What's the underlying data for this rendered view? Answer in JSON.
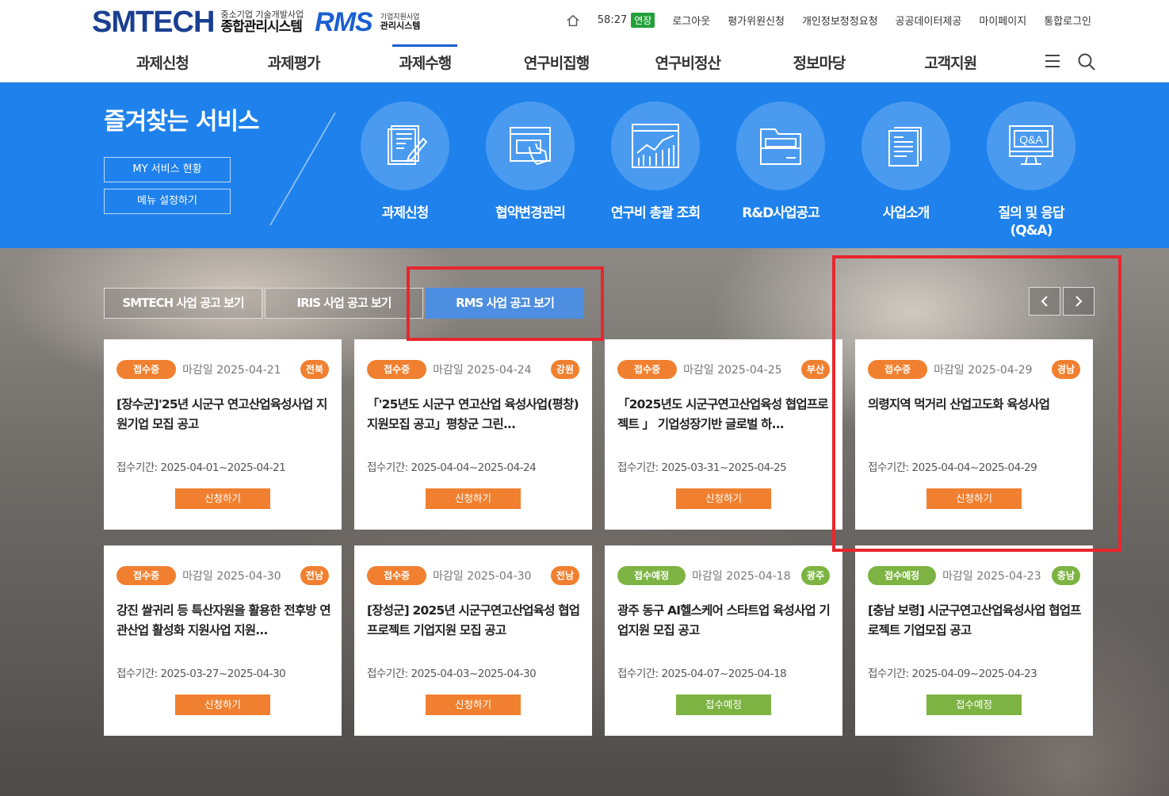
{
  "header": {
    "logo_smtech": "SMTECH",
    "logo_smtech_sub1": "중소기업 기술개발사업",
    "logo_smtech_sub2": "종합관리시스템",
    "logo_rms": "RMS",
    "logo_rms_sub1": "기업지원사업",
    "logo_rms_sub2": "관리시스템",
    "session_time": "58:27",
    "extend_label": "연장",
    "util_links": [
      "로그아웃",
      "평가위원신청",
      "개인정보정정요청",
      "공공데이터제공",
      "마이페이지",
      "통합로그인"
    ],
    "gnb": [
      "과제신청",
      "과제평가",
      "과제수행",
      "연구비집행",
      "연구비정산",
      "정보마당",
      "고객지원"
    ],
    "gnb_active_index": 2
  },
  "favorites": {
    "title": "즐겨찾는 서비스",
    "my_service": "MY 서비스 현황",
    "menu_setting": "메뉴 설정하기",
    "services": [
      {
        "label": "과제신청",
        "icon": "document-edit-icon"
      },
      {
        "label": "협약변경관리",
        "icon": "window-hand-icon"
      },
      {
        "label": "연구비 총괄 조회",
        "icon": "chart-icon"
      },
      {
        "label": "R&D사업공고",
        "icon": "folder-icon"
      },
      {
        "label": "사업소개",
        "icon": "document-list-icon"
      },
      {
        "label": "질의 및 응답\n(Q&A)",
        "icon": "qa-monitor-icon"
      }
    ]
  },
  "tabs": [
    "SMTECH 사업 공고 보기",
    "IRIS 사업 공고 보기",
    "RMS 사업 공고 보기"
  ],
  "active_tab": 2,
  "cards": [
    {
      "status": "접수중",
      "deadline": "마감일 2025-04-21",
      "region": "전북",
      "title": "[장수군]'25년 시군구 연고산업육성사업 지원기업 모집 공고",
      "period": "접수기간: 2025-04-01~2025-04-21",
      "button": "신청하기",
      "color": "orange"
    },
    {
      "status": "접수중",
      "deadline": "마감일 2025-04-24",
      "region": "강원",
      "title": "「'25년도 시군구 연고산업 육성사업(평창) 지원모집 공고」평창군 그린...",
      "period": "접수기간: 2025-04-04~2025-04-24",
      "button": "신청하기",
      "color": "orange"
    },
    {
      "status": "접수중",
      "deadline": "마감일 2025-04-25",
      "region": "부산",
      "title": "「2025년도 시군구연고산업육성 협업프로젝트 」 기업성장기반 글로벌 하...",
      "period": "접수기간: 2025-03-31~2025-04-25",
      "button": "신청하기",
      "color": "orange"
    },
    {
      "status": "접수중",
      "deadline": "마감일 2025-04-29",
      "region": "경남",
      "title": "의령지역 먹거리 산업고도화 육성사업",
      "period": "접수기간: 2025-04-04~2025-04-29",
      "button": "신청하기",
      "color": "orange"
    },
    {
      "status": "접수중",
      "deadline": "마감일 2025-04-30",
      "region": "전남",
      "title": "강진 쌀귀리 등 특산자원을 활용한 전후방 연관산업 활성화 지원사업 지원...",
      "period": "접수기간: 2025-03-27~2025-04-30",
      "button": "신청하기",
      "color": "orange"
    },
    {
      "status": "접수중",
      "deadline": "마감일 2025-04-30",
      "region": "전남",
      "title": "[장성군] 2025년 시군구연고산업육성 협업프로젝트 기업지원 모집 공고",
      "period": "접수기간: 2025-04-03~2025-04-30",
      "button": "신청하기",
      "color": "orange"
    },
    {
      "status": "접수예정",
      "deadline": "마감일 2025-04-18",
      "region": "광주",
      "title": "광주 동구 AI헬스케어 스타트업 육성사업 기업지원 모집 공고",
      "period": "접수기간: 2025-04-07~2025-04-18",
      "button": "접수예정",
      "color": "green"
    },
    {
      "status": "접수예정",
      "deadline": "마감일 2025-04-23",
      "region": "충남",
      "title": "[충남 보령] 시군구연고산업육성사업 협업프로젝트 기업모집 공고",
      "period": "접수기간: 2025-04-09~2025-04-23",
      "button": "접수예정",
      "color": "green"
    }
  ],
  "colors": {
    "brand_blue": "#1f82ec",
    "orange": "#f08030",
    "green": "#7cb342",
    "highlight_red": "#e8262d"
  }
}
